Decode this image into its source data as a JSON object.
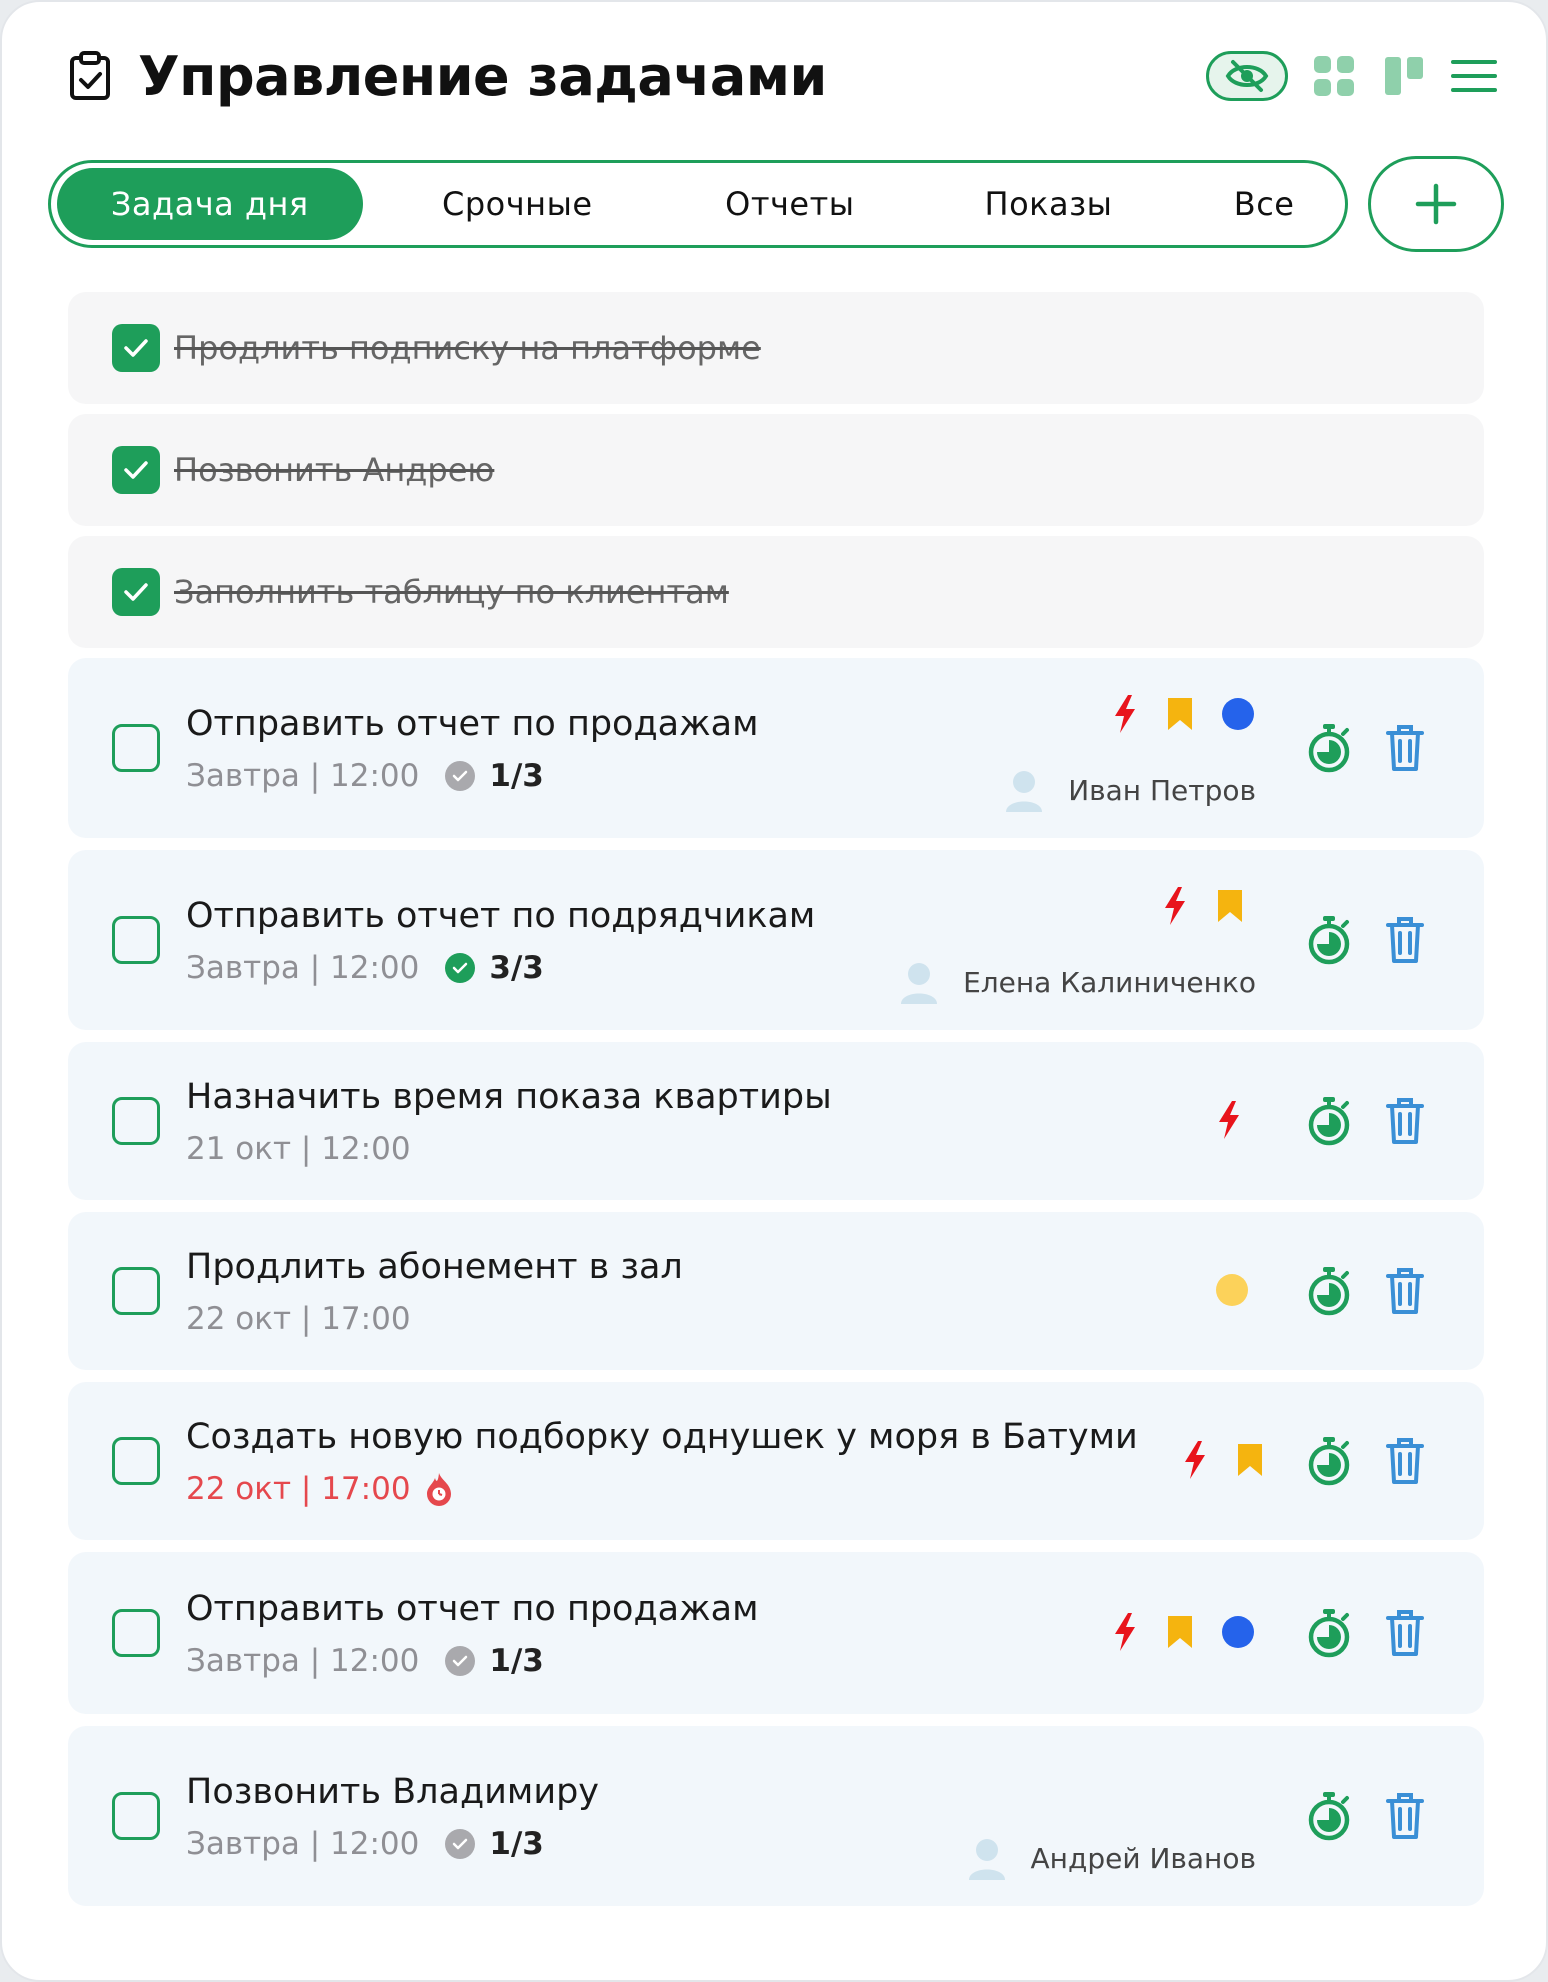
{
  "header": {
    "title": "Управление задачами",
    "icons": [
      "clipboard-check-icon",
      "eye-off-icon",
      "grid-icon",
      "board-icon",
      "menu-icon"
    ]
  },
  "tabs": [
    {
      "label": "Задача дня",
      "active": true
    },
    {
      "label": "Срочные",
      "active": false
    },
    {
      "label": "Отчеты",
      "active": false
    },
    {
      "label": "Показы",
      "active": false
    },
    {
      "label": "Все",
      "active": false
    }
  ],
  "completed_tasks": [
    {
      "title": "Продлить подписку на платформе"
    },
    {
      "title": "Позвонить Андрею"
    },
    {
      "title": "Заполнить таблицу по клиентам"
    }
  ],
  "tasks": [
    {
      "title": "Отправить отчет по продажам",
      "meta": "Завтра | 12:00",
      "subtasks": "1/3",
      "subtasks_done": false,
      "flags": [
        "lightning",
        "bookmark",
        "blue-dot"
      ],
      "assignee": "Иван Петров",
      "overdue": false
    },
    {
      "title": "Отправить отчет по подрядчикам",
      "meta": "Завтра | 12:00",
      "subtasks": "3/3",
      "subtasks_done": true,
      "flags": [
        "lightning",
        "bookmark"
      ],
      "assignee": "Елена Калиниченко",
      "overdue": false
    },
    {
      "title": "Назначить время показа квартиры",
      "meta": "21 окт | 12:00",
      "flags": [
        "lightning"
      ],
      "overdue": false
    },
    {
      "title": "Продлить абонемент в зал",
      "meta": "22 окт | 17:00",
      "flags": [
        "yellow-dot"
      ],
      "overdue": false
    },
    {
      "title": "Создать новую подборку однушек у моря в Батуми",
      "meta": "22 окт | 17:00",
      "flags": [
        "lightning",
        "bookmark"
      ],
      "overdue": true
    },
    {
      "title": "Отправить отчет по продажам",
      "meta": "Завтра | 12:00",
      "subtasks": "1/3",
      "subtasks_done": false,
      "flags": [
        "lightning",
        "bookmark",
        "blue-dot"
      ],
      "overdue": false
    },
    {
      "title": "Позвонить Владимиру",
      "meta": "Завтра | 12:00",
      "subtasks": "1/3",
      "subtasks_done": false,
      "flags": [],
      "assignee": "Андрей Иванов",
      "overdue": false
    }
  ],
  "colors": {
    "accent": "#1e9e5a",
    "overdue": "#e5484d",
    "lightning": "#e8141c",
    "bookmark": "#f5b40f",
    "blue_dot": "#2563eb",
    "yellow_dot": "#fcd25a",
    "trash": "#3a8fd6"
  }
}
